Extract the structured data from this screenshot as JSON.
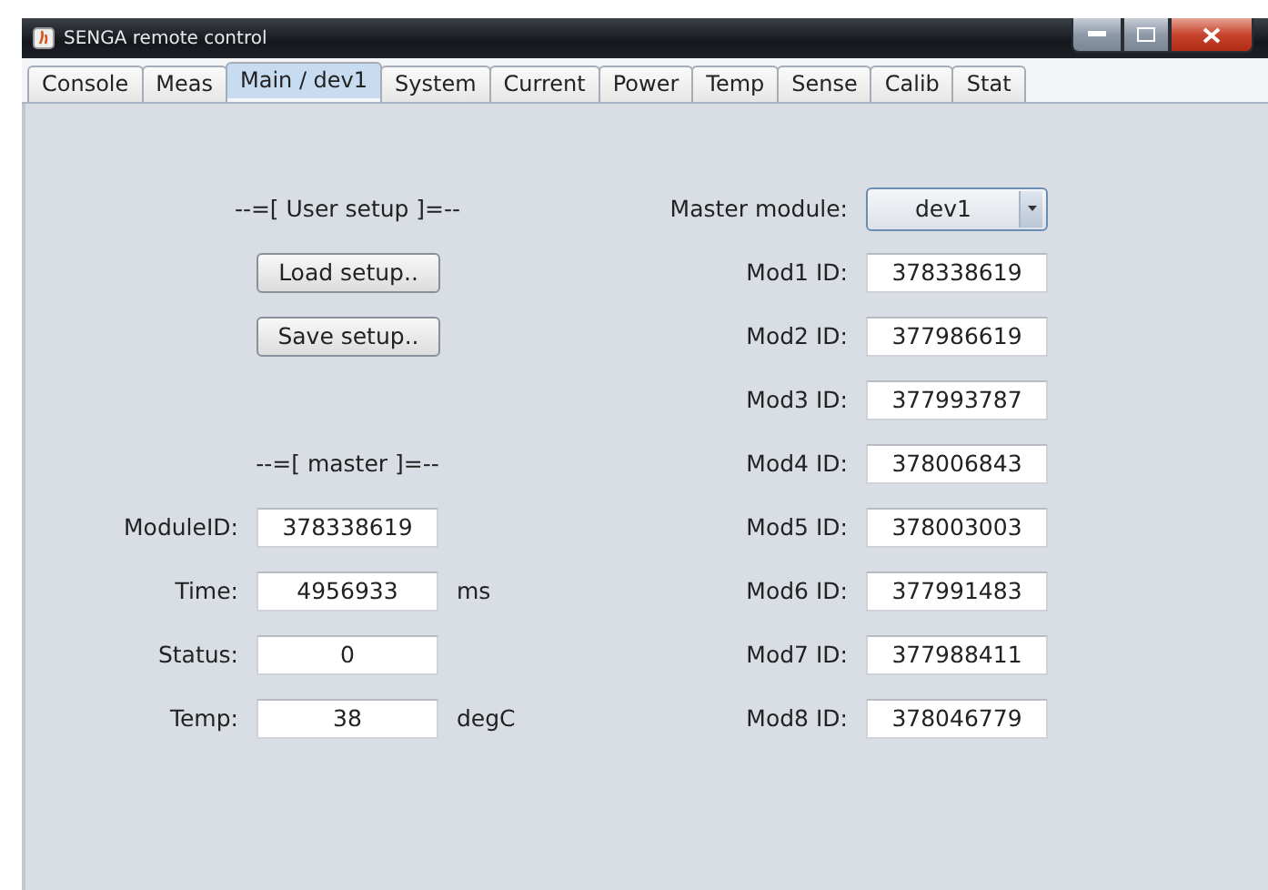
{
  "window": {
    "title": "SENGA remote control"
  },
  "tabs": [
    {
      "label": "Console",
      "selected": false
    },
    {
      "label": "Meas",
      "selected": false
    },
    {
      "label": "Main / dev1",
      "selected": true
    },
    {
      "label": "System",
      "selected": false
    },
    {
      "label": "Current",
      "selected": false
    },
    {
      "label": "Power",
      "selected": false
    },
    {
      "label": "Temp",
      "selected": false
    },
    {
      "label": "Sense",
      "selected": false
    },
    {
      "label": "Calib",
      "selected": false
    },
    {
      "label": "Stat",
      "selected": false
    }
  ],
  "user_setup": {
    "heading": "--=[ User setup ]=--",
    "buttons": [
      "Load setup..",
      "Save setup.."
    ]
  },
  "master": {
    "heading": "--=[ master ]=--",
    "fields": [
      {
        "label": "ModuleID:",
        "value": "378338619"
      },
      {
        "label": "Time:",
        "value": "4956933",
        "unit": "ms"
      },
      {
        "label": "Status:",
        "value": "0"
      },
      {
        "label": "Temp:",
        "value": "38",
        "unit": "degC"
      }
    ]
  },
  "master_module": {
    "label": "Master module:",
    "value": "dev1"
  },
  "modules": [
    {
      "label": "Mod1 ID:",
      "value": "378338619"
    },
    {
      "label": "Mod2 ID:",
      "value": "377986619"
    },
    {
      "label": "Mod3 ID:",
      "value": "377993787"
    },
    {
      "label": "Mod4 ID:",
      "value": "378006843"
    },
    {
      "label": "Mod5 ID:",
      "value": "378003003"
    },
    {
      "label": "Mod6 ID:",
      "value": "377991483"
    },
    {
      "label": "Mod7 ID:",
      "value": "377988411"
    },
    {
      "label": "Mod8 ID:",
      "value": "378046779"
    }
  ]
}
